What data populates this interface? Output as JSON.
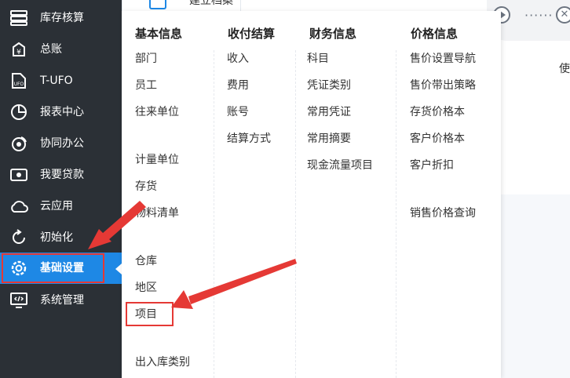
{
  "sidebar": {
    "items": [
      {
        "label": "库存核算",
        "icon": "inventory-icon"
      },
      {
        "label": "总账",
        "icon": "ledger-icon"
      },
      {
        "label": "T-UFO",
        "icon": "ufo-icon"
      },
      {
        "label": "报表中心",
        "icon": "report-icon"
      },
      {
        "label": "协同办公",
        "icon": "collab-icon"
      },
      {
        "label": "我要贷款",
        "icon": "loan-icon"
      },
      {
        "label": "云应用",
        "icon": "cloud-icon"
      },
      {
        "label": "初始化",
        "icon": "init-icon"
      },
      {
        "label": "基础设置",
        "icon": "settings-icon"
      },
      {
        "label": "系统管理",
        "icon": "system-icon"
      }
    ],
    "active": "基础设置"
  },
  "background": {
    "tab_label": "建立档案",
    "side_char": "使"
  },
  "menu": {
    "basic": {
      "title": "基本信息",
      "items": [
        "部门",
        "员工",
        "往来单位",
        "计量单位",
        "存货",
        "物料清单",
        "仓库",
        "地区",
        "项目",
        "出入库类别"
      ]
    },
    "payment": {
      "title": "收付结算",
      "items": [
        "收入",
        "费用",
        "账号",
        "结算方式"
      ]
    },
    "finance": {
      "title": "财务信息",
      "items": [
        "科目",
        "凭证类别",
        "常用凭证",
        "常用摘要",
        "现金流量项目"
      ]
    },
    "price": {
      "title": "价格信息",
      "items": [
        "售价设置导航",
        "售价带出策略",
        "存货价格本",
        "客户价格本",
        "客户折扣",
        "销售价格查询"
      ]
    }
  },
  "colors": {
    "sidebar_bg": "#2b3036",
    "active_bg": "#1e88e5",
    "highlight": "#e53935"
  }
}
